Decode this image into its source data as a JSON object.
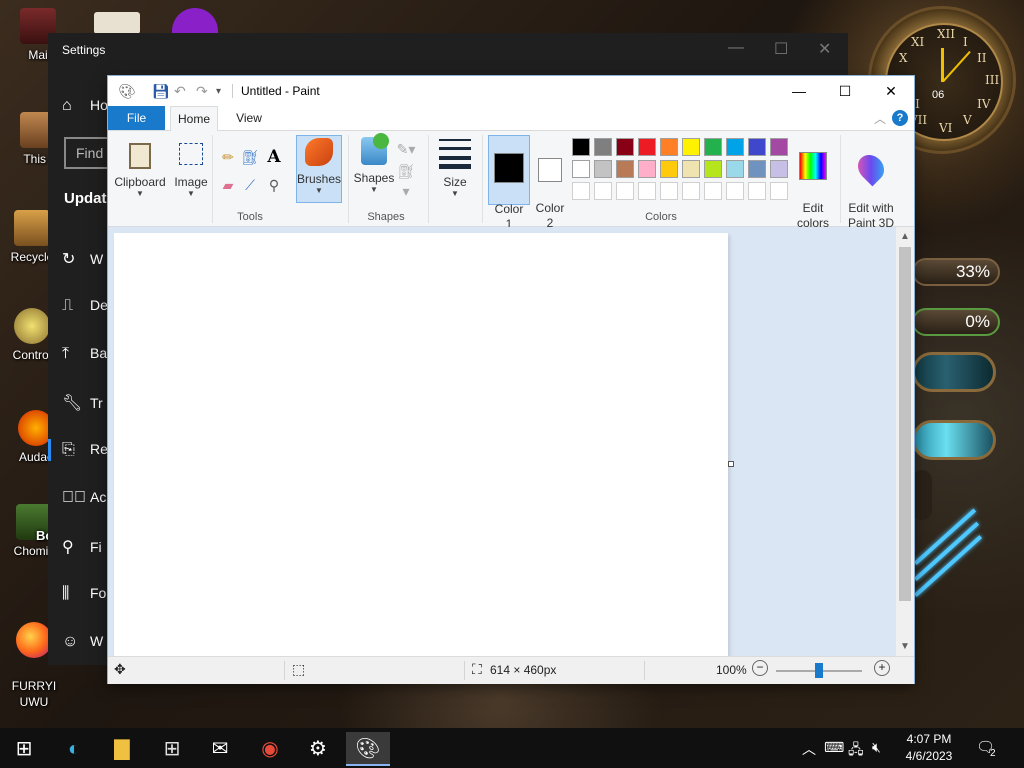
{
  "settings": {
    "title": "Settings",
    "nav": [
      {
        "icon": "home-icon",
        "label": "Ho"
      },
      {
        "icon": "sync-icon",
        "label": "W"
      },
      {
        "icon": "delivery-icon",
        "label": "De"
      },
      {
        "icon": "backup-icon",
        "label": "Ba"
      },
      {
        "icon": "wrench-icon",
        "label": "Tr"
      },
      {
        "icon": "recovery-icon",
        "label": "Re"
      },
      {
        "icon": "activation-icon",
        "label": "Ac"
      },
      {
        "icon": "find-device-icon",
        "label": "Fi"
      },
      {
        "icon": "developer-icon",
        "label": "Fo"
      },
      {
        "icon": "insider-icon",
        "label": "W"
      }
    ],
    "search_placeholder": "Find",
    "heading": "Update"
  },
  "desktop": {
    "icons": [
      {
        "label": "Mai",
        "icon": "app-icon"
      },
      {
        "label": "This I",
        "icon": "computer-icon"
      },
      {
        "label": "Recycle",
        "icon": "recycle-bin-icon"
      },
      {
        "label": "Control",
        "icon": "control-panel-icon"
      },
      {
        "label": "Audac",
        "icon": "audacity-icon"
      },
      {
        "label": "Chomik",
        "icon": "chomik-icon"
      },
      {
        "label": "FURRYI\nUWU",
        "icon": "firefox-icon"
      }
    ],
    "clock_date": "06",
    "gauge_1": "33%",
    "gauge_2": "0%",
    "partial_label": "Bo"
  },
  "paint": {
    "title": "Untitled - Paint",
    "tabs": {
      "file": "File",
      "home": "Home",
      "view": "View"
    },
    "ribbon": {
      "clipboard": "Clipboard",
      "image": "Image",
      "tools": "Tools",
      "brushes": "Brushes",
      "shapes_btn": "Shapes",
      "shapes_group": "Shapes",
      "size": "Size",
      "color1": "Color\n1",
      "color2": "Color\n2",
      "edit_colors": "Edit\ncolors",
      "edit_paint3d": "Edit with\nPaint 3D",
      "colors_group": "Colors"
    },
    "palette": [
      "#000000",
      "#7f7f7f",
      "#880015",
      "#ed1c24",
      "#ff7f27",
      "#fff200",
      "#22b14c",
      "#00a2e8",
      "#3f48cc",
      "#a349a4",
      "#ffffff",
      "#c3c3c3",
      "#b97a57",
      "#ffaec9",
      "#ffc90e",
      "#efe4b0",
      "#b5e61d",
      "#99d9ea",
      "#7092be",
      "#c8bfe7"
    ],
    "status": {
      "dimensions": "614 × 460px",
      "zoom": "100%",
      "zoom_fraction": 0.5
    }
  },
  "taskbar": {
    "time": "4:07 PM",
    "date": "4/6/2023",
    "apps": [
      "edge-icon",
      "file-explorer-icon",
      "store-icon",
      "mail-icon",
      "chrome-icon",
      "settings-icon",
      "paint-icon"
    ],
    "notification_count": "2"
  }
}
